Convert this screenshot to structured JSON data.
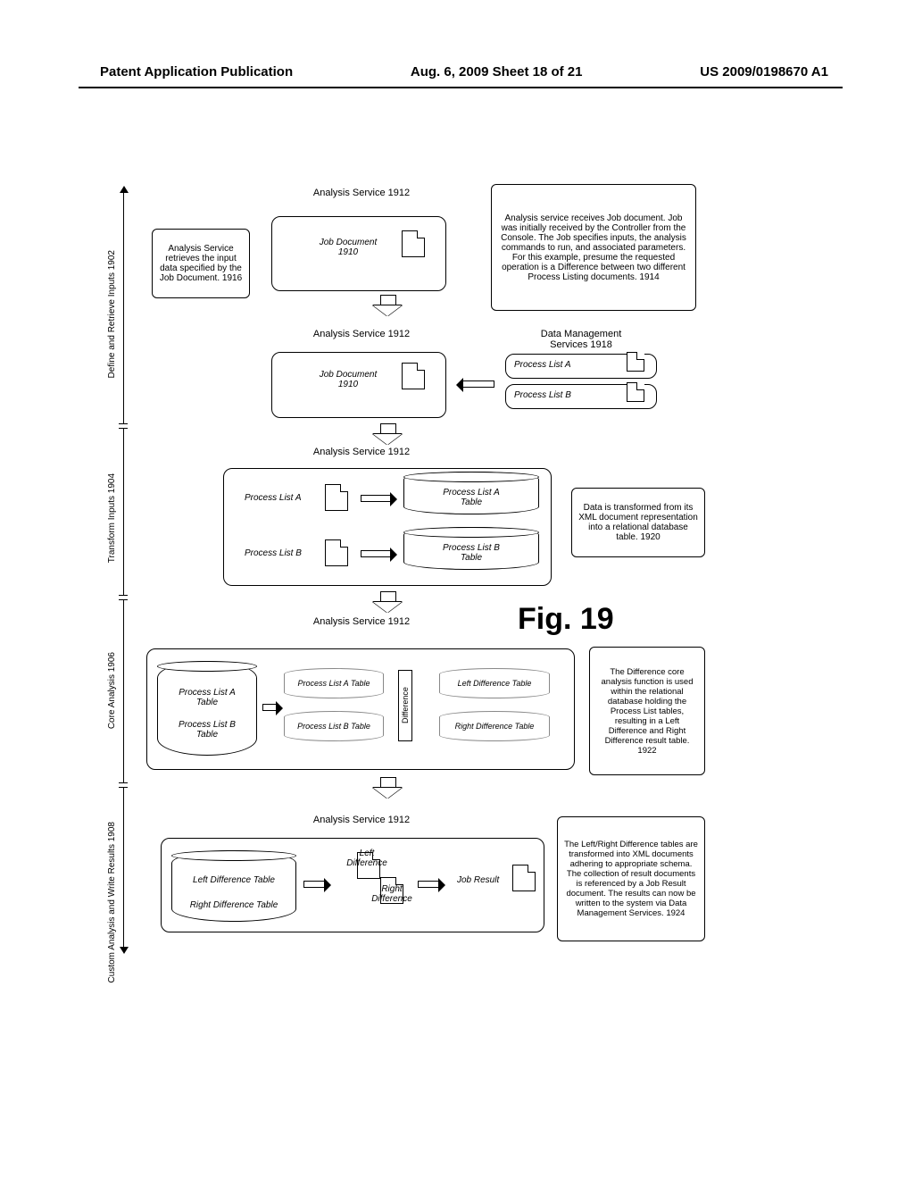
{
  "header": {
    "left": "Patent Application Publication",
    "center": "Aug. 6, 2009  Sheet 18 of 21",
    "right": "US 2009/0198670 A1"
  },
  "figure_title": "Fig. 19",
  "phases": {
    "define": "Define and Retrieve Inputs  1902",
    "transform": "Transform Inputs  1904",
    "core": "Core Analysis  1906",
    "custom": "Custom Analysis and\nWrite Results  1908"
  },
  "labels": {
    "analysis_service": "Analysis Service  1912",
    "job_doc": "Job Document",
    "job_doc_num": "1910",
    "data_mgmt": "Data Management",
    "data_mgmt_sub": "Services  1918",
    "plist_a": "Process List A",
    "plist_b": "Process List B",
    "plist_a_table": "Process List A\nTable",
    "plist_b_table": "Process List B\nTable",
    "left_diff": "Left Difference\nTable",
    "right_diff": "Right Difference\nTable",
    "difference": "Difference",
    "left_diff_xml": "Left\nDifference",
    "right_diff_xml": "Right\nDifference",
    "job_result": "Job Result",
    "left_diff_tbl": "Left Difference Table",
    "right_diff_tbl": "Right Difference Table"
  },
  "notes": {
    "n1916": "Analysis Service retrieves the input data specified by the Job Document.\n1916",
    "n1914": "Analysis service receives Job document. Job was initially received by the Controller from the Console. The Job specifies inputs, the analysis commands to run, and associated parameters. For this example, presume the requested operation is a Difference between two different Process Listing documents.\n1914",
    "n1920": "Data is transformed from its XML document representation into a relational database table.\n1920",
    "n1922": "The Difference core analysis function is used within the relational database holding the Process List tables, resulting in a Left Difference and Right Difference result table.\n1922",
    "n1924": "The Left/Right Difference tables are transformed into XML documents adhering to appropriate schema. The collection of result documents is referenced by a Job Result document. The results can now be written to the system via Data Management Services.\n1924"
  }
}
